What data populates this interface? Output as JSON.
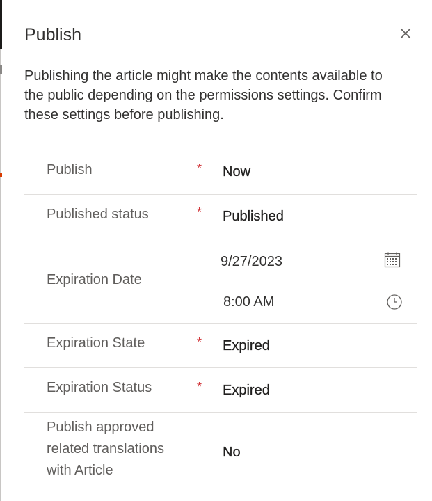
{
  "dialog": {
    "title": "Publish",
    "close_icon": "close-icon",
    "description": "Publishing the article might make the contents available to the public depending on the permissions settings. Confirm these settings before publishing."
  },
  "fields": [
    {
      "label": "Publish",
      "required": "*",
      "value": "Now"
    },
    {
      "label": "Published status",
      "required": "*",
      "value": "Published"
    },
    {
      "label": "Expiration Date",
      "date": "9/27/2023",
      "time": "8:00 AM",
      "date_icon": "calendar-icon",
      "time_icon": "clock-icon"
    },
    {
      "label": "Expiration State",
      "required": "*",
      "value": "Expired"
    },
    {
      "label": "Expiration Status",
      "required": "*",
      "value": "Expired"
    },
    {
      "label": "Publish approved related translations with Article",
      "value": "No"
    }
  ],
  "colors": {
    "required": "#d13438",
    "divider": "#e1dfdd",
    "label": "#605e5c",
    "text": "#323130"
  }
}
